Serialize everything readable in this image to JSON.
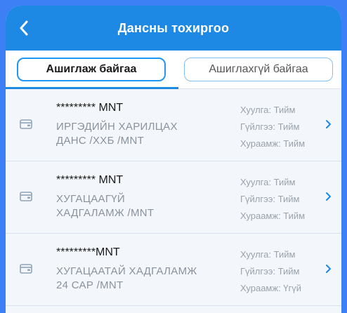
{
  "header": {
    "title": "Дансны тохиргоо"
  },
  "tabs": [
    {
      "label": "Ашиглаж байгаа"
    },
    {
      "label": "Ашиглахгүй байгаа"
    }
  ],
  "accounts": [
    {
      "number": "********* MNT",
      "name_line1": "ИРГЭДИЙН ХАРИЛЦАХ",
      "name_line2": "ДАНС /ХХБ /MNT",
      "view": "Хуулга: Тийм",
      "transaction": "Гүйлгээ: Тийм",
      "savings": "Хураамж: Тийм"
    },
    {
      "number": "********* MNT",
      "name_line1": "ХУГАЦААГҮЙ",
      "name_line2": "ХАДГАЛАМЖ /MNT",
      "view": "Хуулга: Тийм",
      "transaction": "Гүйлгээ: Тийм",
      "savings": "Хураамж: Тийм"
    },
    {
      "number": "*********MNT",
      "name_line1": "ХУГАЦААТАЙ ХАДГАЛАМЖ",
      "name_line2": "24 САР /MNT",
      "view": "Хуулга: Тийм",
      "transaction": "Гүйлгээ: Тийм",
      "savings": "Хураамж: Үгүй"
    }
  ],
  "icons": {
    "back": "back-arrow-icon",
    "wallet": "wallet-icon",
    "chevron": "chevron-right-icon"
  },
  "colors": {
    "brand": "#1e88e5",
    "background": "#3d7ff5",
    "tab_border": "#2196f3"
  }
}
